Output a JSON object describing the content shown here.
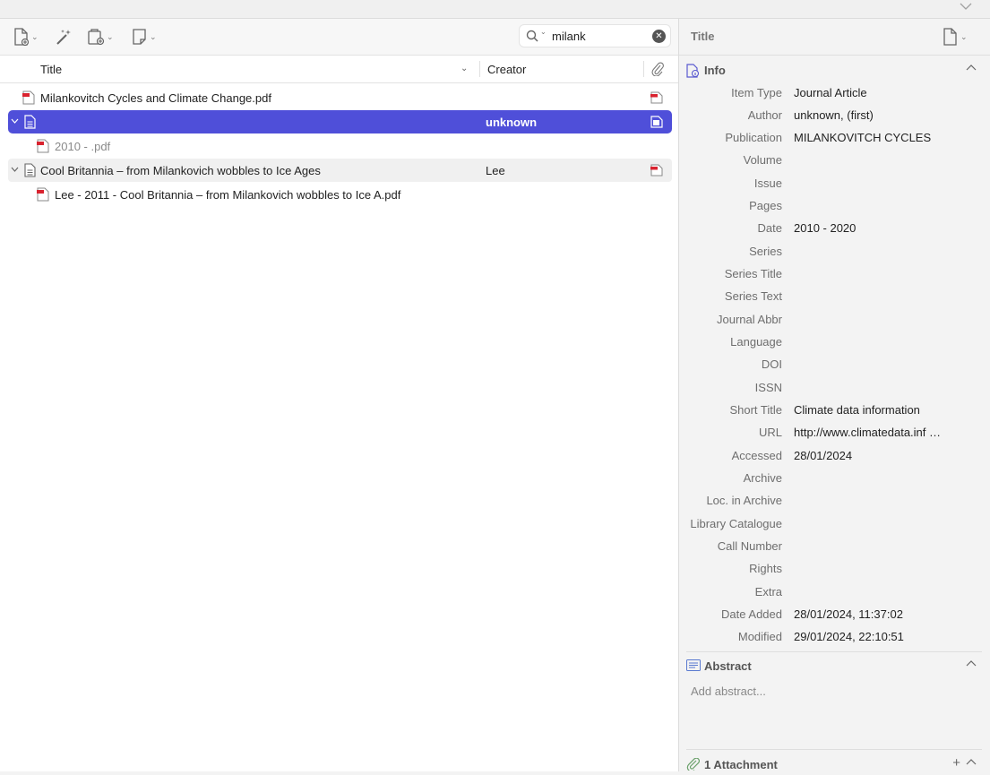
{
  "search": {
    "value": "milank"
  },
  "columns": {
    "title": "Title",
    "creator": "Creator"
  },
  "rows": [
    {
      "title": "Milankovitch Cycles and Climate Change.pdf",
      "creator": ""
    },
    {
      "title": "",
      "creator": "unknown"
    },
    {
      "title": "2010 - .pdf",
      "creator": ""
    },
    {
      "title": "Cool Britannia – from Milankovich wobbles to Ice Ages",
      "creator": "Lee"
    },
    {
      "title": "Lee - 2011 - Cool Britannia – from Milankovich wobbles to Ice A.pdf",
      "creator": ""
    }
  ],
  "item_pane": {
    "header_title": "Title",
    "info_label": "Info",
    "fields": [
      {
        "label": "Item Type",
        "value": "Journal Article"
      },
      {
        "label": "Author",
        "value": "unknown, (first)"
      },
      {
        "label": "Publication",
        "value": "MILANKOVITCH CYCLES"
      },
      {
        "label": "Volume",
        "value": ""
      },
      {
        "label": "Issue",
        "value": ""
      },
      {
        "label": "Pages",
        "value": ""
      },
      {
        "label": "Date",
        "value": "2010 - 2020"
      },
      {
        "label": "Series",
        "value": ""
      },
      {
        "label": "Series Title",
        "value": ""
      },
      {
        "label": "Series Text",
        "value": ""
      },
      {
        "label": "Journal Abbr",
        "value": ""
      },
      {
        "label": "Language",
        "value": ""
      },
      {
        "label": "DOI",
        "value": ""
      },
      {
        "label": "ISSN",
        "value": ""
      },
      {
        "label": "Short Title",
        "value": "Climate data information"
      },
      {
        "label": "URL",
        "value": "http://www.climatedata.inf …"
      },
      {
        "label": "Accessed",
        "value": "28/01/2024"
      },
      {
        "label": "Archive",
        "value": ""
      },
      {
        "label": "Loc. in Archive",
        "value": ""
      },
      {
        "label": "Library Catalogue",
        "value": ""
      },
      {
        "label": "Call Number",
        "value": ""
      },
      {
        "label": "Rights",
        "value": ""
      },
      {
        "label": "Extra",
        "value": ""
      },
      {
        "label": "Date Added",
        "value": "28/01/2024, 11:37:02"
      },
      {
        "label": "Modified",
        "value": "29/01/2024, 22:10:51"
      }
    ],
    "abstract_label": "Abstract",
    "abstract_placeholder": "Add abstract...",
    "attachments_label": "1 Attachment"
  },
  "colors": {
    "selection": "#4f4fd9",
    "pdf_red": "#d9232f"
  },
  "icons": [
    "new-item-icon",
    "magic-wand-icon",
    "add-attachment-icon",
    "new-note-icon",
    "search-icon",
    "clear-icon",
    "paperclip-icon",
    "pdf-icon",
    "document-icon",
    "info-icon",
    "abstract-icon"
  ]
}
